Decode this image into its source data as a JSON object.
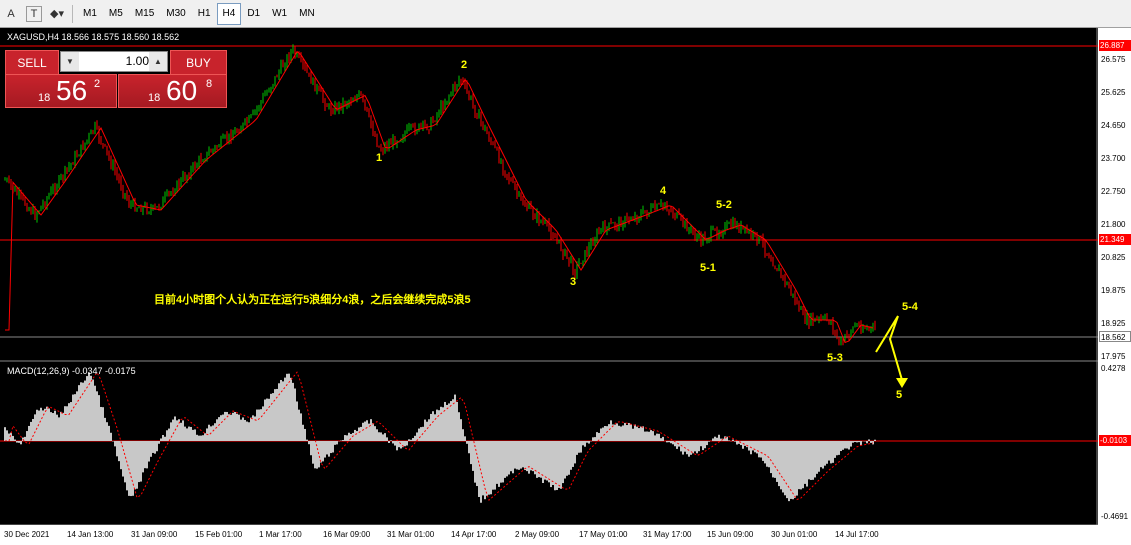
{
  "toolbar": {
    "timeframes": [
      "M1",
      "M5",
      "M15",
      "M30",
      "H1",
      "H4",
      "D1",
      "W1",
      "MN"
    ],
    "active": "H4"
  },
  "symbol_line": "XAGUSD,H4  18.566 18.575 18.560 18.562",
  "trade_panel": {
    "sell_label": "SELL",
    "buy_label": "BUY",
    "lot_value": "1.00",
    "sell_small": "18",
    "sell_big": "56",
    "sell_sup": "2",
    "buy_small": "18",
    "buy_big": "60",
    "buy_sup": "8"
  },
  "price_axis": {
    "ticks": [
      "26.575",
      "25.625",
      "24.650",
      "23.700",
      "22.750",
      "21.800",
      "20.825",
      "19.875",
      "18.925",
      "17.975"
    ],
    "highlight_top": "26.887",
    "highlight_mid": "21.349",
    "current": "18.562"
  },
  "macd": {
    "label": "MACD(12,26,9) -0.0347 -0.0175",
    "top": "0.4278",
    "zero": "-0.0103",
    "bottom": "-0.4691"
  },
  "time_axis": [
    "30 Dec 2021",
    "14 Jan 13:00",
    "31 Jan 09:00",
    "15 Feb 01:00",
    "1 Mar 17:00",
    "16 Mar 09:00",
    "31 Mar 01:00",
    "14 Apr 17:00",
    "2 May 09:00",
    "17 May 01:00",
    "31 May 17:00",
    "15 Jun 09:00",
    "30 Jun 01:00",
    "14 Jul 17:00"
  ],
  "waves": {
    "w1": "1",
    "w2": "2",
    "w3": "3",
    "w4": "4",
    "w51": "5-1",
    "w52": "5-2",
    "w53": "5-3",
    "w54": "5-4",
    "w5": "5"
  },
  "annotation": "目前4小时图个人认为正在运行5浪细分4浪，之后会继续完成5浪5",
  "colors": {
    "bull": "#00c800",
    "bear": "#ff0000",
    "ma": "#ff0000",
    "annotation": "#ffff00",
    "panel": "#c8232c"
  }
}
